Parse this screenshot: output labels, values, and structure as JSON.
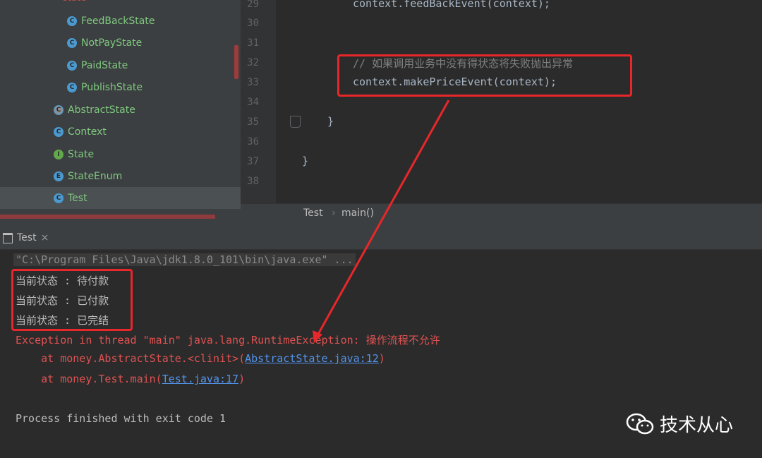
{
  "tree": {
    "items": [
      {
        "label": "FeedBackState",
        "icon": "class-icon"
      },
      {
        "label": "NotPayState",
        "icon": "class-icon"
      },
      {
        "label": "PaidState",
        "icon": "class-icon"
      },
      {
        "label": "PublishState",
        "icon": "class-icon"
      },
      {
        "label": "AbstractState",
        "icon": "abstract-class-icon"
      },
      {
        "label": "Context",
        "icon": "class-icon"
      },
      {
        "label": "State",
        "icon": "interface-icon"
      },
      {
        "label": "StateEnum",
        "icon": "enum-icon"
      },
      {
        "label": "Test",
        "icon": "runnable-class-icon",
        "selected": true
      }
    ]
  },
  "editor": {
    "line_numbers": [
      "29",
      "30",
      "31",
      "32",
      "33",
      "34",
      "35",
      "36",
      "37",
      "38"
    ],
    "lines": {
      "l29": "context.feedBackEvent(context);",
      "l32": "// 如果调用业务中没有得状态将失败抛出异常",
      "l33": "context.makePriceEvent(context);",
      "l35": "}",
      "l37": "}"
    }
  },
  "breadcrumb": {
    "file": "Test",
    "method": "main()"
  },
  "run_panel": {
    "tab_label": "Test",
    "close_glyph": "×"
  },
  "console": {
    "command": "\"C:\\Program Files\\Java\\jdk1.8.0_101\\bin\\java.exe\" ...",
    "states": [
      "当前状态 : 待付款",
      "当前状态 : 已付款",
      "当前状态 : 已完结"
    ],
    "exception": "Exception in thread \"main\" java.lang.RuntimeException: 操作流程不允许",
    "trace1_prefix": "    at money.AbstractState.<clinit>(",
    "trace1_link": "AbstractState.java:12",
    "trace1_suffix": ")",
    "trace2_prefix": "    at money.Test.main(",
    "trace2_link": "Test.java:17",
    "trace2_suffix": ")",
    "exit": "Process finished with exit code 1"
  },
  "watermark": {
    "text": "技术从心",
    "icon": "wechat-icon"
  },
  "colors": {
    "annotation": "#e8272a",
    "error": "#e05252",
    "link": "#5394ec"
  }
}
